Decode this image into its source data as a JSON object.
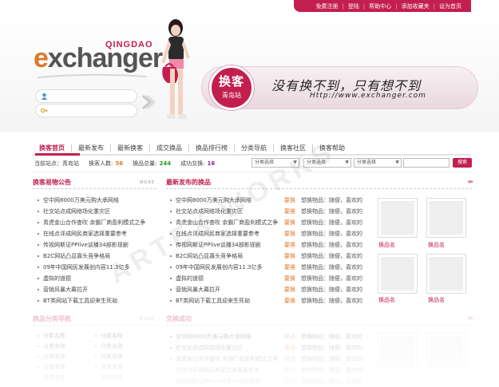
{
  "topbar": {
    "links": [
      "免费注册",
      "登陆",
      "帮助中心",
      "添加收藏夹",
      "设为首页"
    ]
  },
  "logo": {
    "small": "QINGDAO",
    "main_e": "e",
    "main_rest": "xchanger"
  },
  "banner": {
    "badge_title": "换客",
    "badge_sub": "青岛站",
    "slogan": "没有换不到，只有想不到",
    "url": "Http://www.exchanger.com"
  },
  "nav": {
    "items": [
      "换客首页",
      "最新发布",
      "最新换客",
      "成交换品",
      "换品排行榜",
      "分类导航",
      "换客社区",
      "换客帮助"
    ]
  },
  "status": {
    "location_label": "当前站点：",
    "location_value": "青岛站",
    "users_label": "换客人数:",
    "users_value": "56",
    "goods_label": "换品总量:",
    "goods_value": "244",
    "success_label": "成功交换:",
    "success_value": "16",
    "select_label": "分类选择",
    "search_button": "搜索"
  },
  "notice": {
    "title": "换客易物公告",
    "more": "MORE",
    "items": [
      "空中网8000万美元购大承网络",
      "社交站点成网络场化重灾区",
      "青虎金山合作查吹 余霸厂商盈利模式之争",
      "在线点评成网民商家选择重要参考",
      "传视网斯证PPlive谈播34部影视剧",
      "B2C网站凸显寡头竞争格局",
      "09年中国网民发展创内容11.3亿多",
      "虚拟的道德",
      "营销风暴大幕拉开",
      "BT类网站下载工具迎来生死劫"
    ]
  },
  "newest": {
    "title": "最新发布的换品",
    "want_label": "要换",
    "desc": "想换物品：随便，喜欢的",
    "items": [
      "空中网8000万美元购大承网络",
      "社交站点成网络场化重灾区",
      "青虎金山合作查吹 余霸厂商盈利模式之争",
      "在线点评成网民商家选择重要参考",
      "传视网斯证PPlive谈播34部影视剧",
      "B2C网站凸显寡头竞争格局",
      "09年中国网民发展创内容11.3亿多",
      "虚拟的道德",
      "营销风暴大幕拉开",
      "BT类网站下载工具迎来生死劫"
    ],
    "thumb_label": "换品名"
  },
  "categories": {
    "title": "换品分类导航",
    "more": "MORE",
    "item_label": "分类名称"
  },
  "success": {
    "title": "交换成功",
    "want_label": "换成",
    "desc": "想换物品：随便，喜欢的",
    "items": [
      "空中网8000万美元购大承网络",
      "社交站点成网络场化重灾区",
      "青虎金山合作查吹 余霸厂商盈利模式之争",
      "在线点评成网民商家选择重要参考",
      "传视网斯证PPlive谈播34部影视剧"
    ]
  },
  "watermark": "ARTEX WORKS",
  "colors": {
    "brand": "#c21f4f",
    "accent": "#e0782a",
    "green": "#2a9a1a"
  }
}
